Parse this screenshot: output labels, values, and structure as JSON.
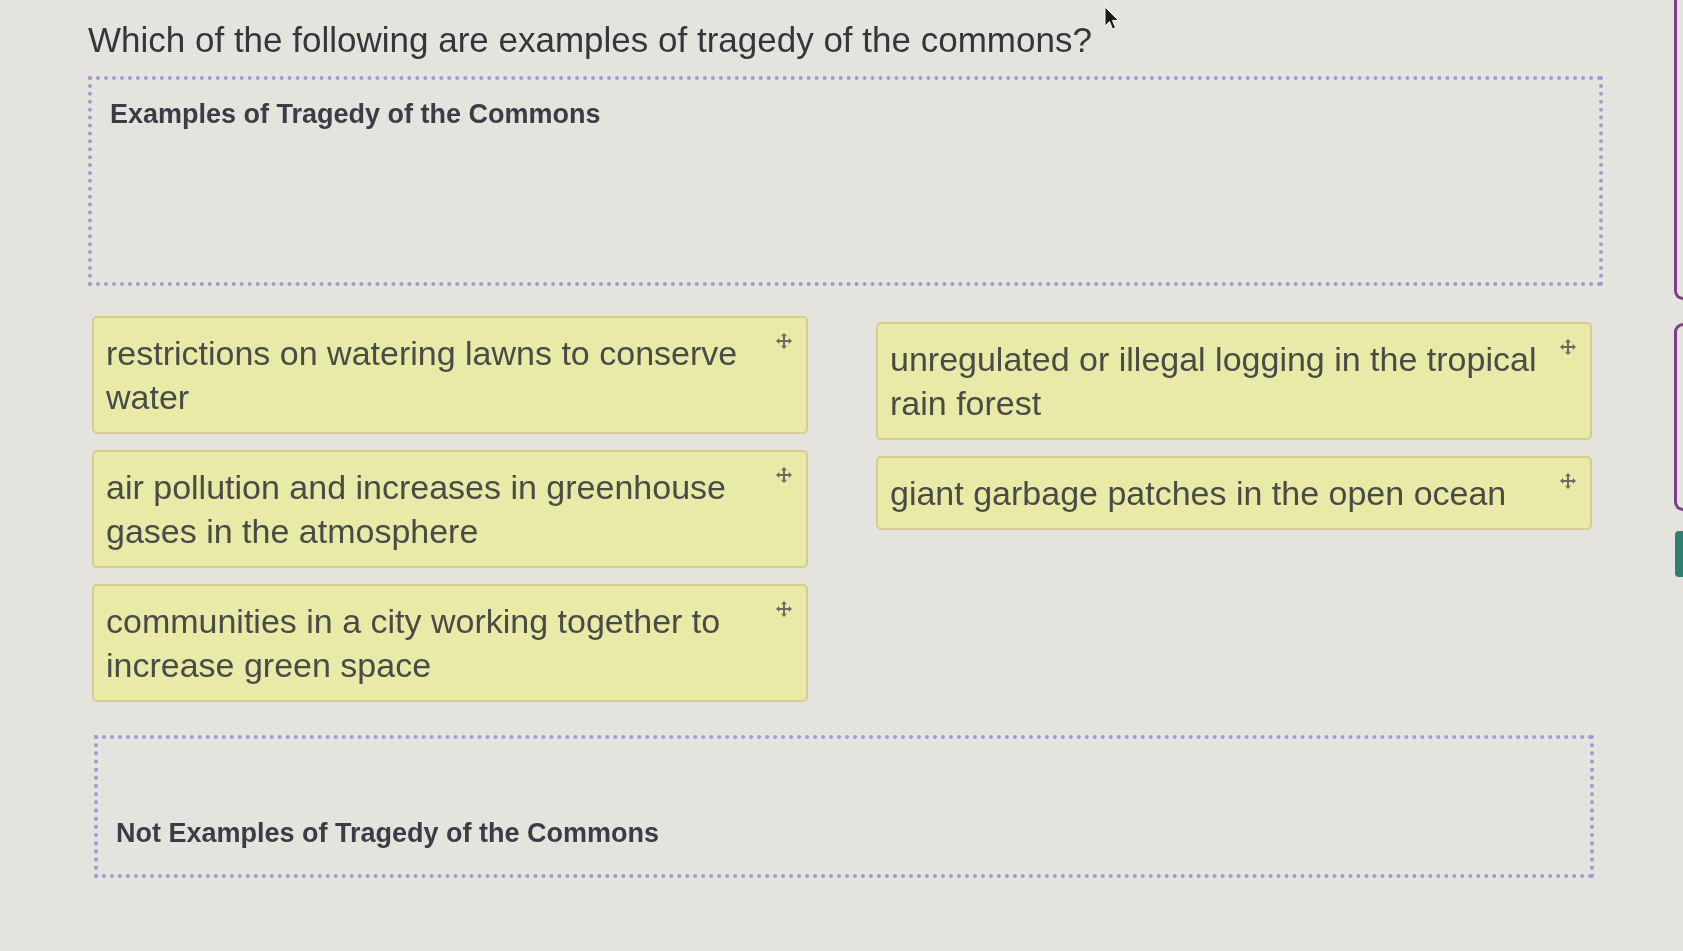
{
  "question": "Which of the following are examples of tragedy of the commons?",
  "drop_zones": [
    {
      "title": "Examples of Tragedy of the Commons",
      "kind": "header"
    },
    {
      "title": "Not Examples of Tragedy of the Commons",
      "kind": "footer"
    }
  ],
  "answer_columns": [
    {
      "cards": [
        {
          "text": "restrictions on watering lawns to conserve water"
        },
        {
          "text": "air pollution and increases in greenhouse gases in the atmosphere"
        },
        {
          "text": "communities in a city working together to increase green space"
        }
      ]
    },
    {
      "cards": [
        {
          "text": "unregulated or illegal logging in the tropical rain forest"
        },
        {
          "text": "giant garbage patches in the open ocean"
        }
      ]
    }
  ]
}
